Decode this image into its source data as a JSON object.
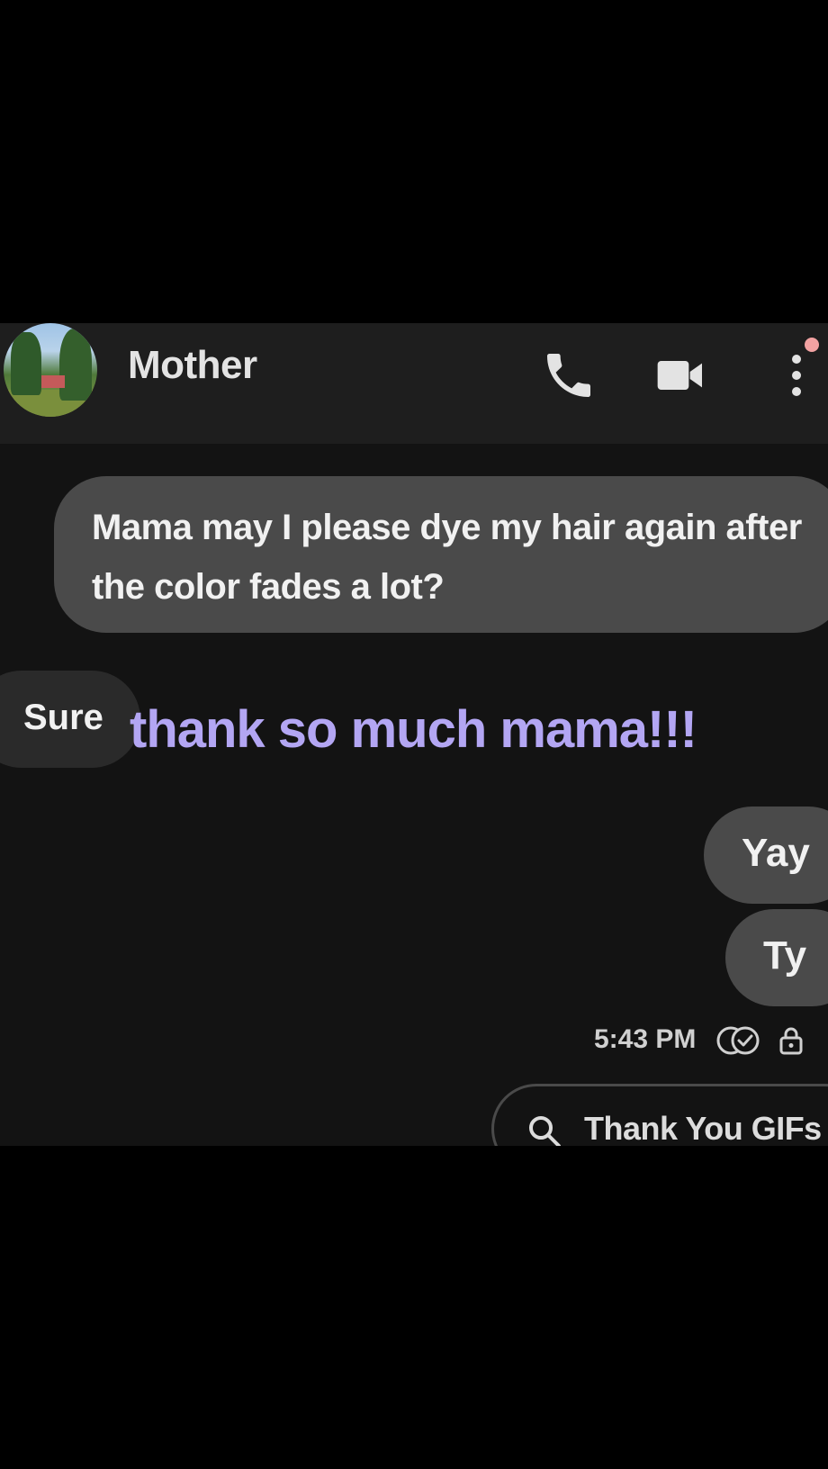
{
  "contact": {
    "name": "Mother",
    "avatar": "avatar-photo-trees-house"
  },
  "header": {
    "call_icon": "phone-icon",
    "video_icon": "video-camera-icon",
    "more_icon": "more-vertical-icon",
    "notification_color": "#f2a2a2"
  },
  "messages": [
    {
      "direction": "outgoing",
      "text": "Mama may I please dye my hair again after the color fades a lot?"
    },
    {
      "direction": "incoming",
      "text": "Sure"
    },
    {
      "direction": "outgoing",
      "text": "Yay"
    },
    {
      "direction": "outgoing",
      "text": "Ty"
    }
  ],
  "overlay": {
    "text": "thank so much mama!!!",
    "color": "#b3a6f3"
  },
  "status": {
    "time": "5:43 PM",
    "read_icon": "read-receipt-icon",
    "encryption_icon": "lock-icon"
  },
  "suggestion": {
    "label": "Thank You GIFs",
    "icon": "search-icon"
  },
  "colors": {
    "background": "#131313",
    "header": "#1e1e1e",
    "outgoing_bubble": "#4a4a4a",
    "incoming_bubble": "#2a2a2a"
  }
}
